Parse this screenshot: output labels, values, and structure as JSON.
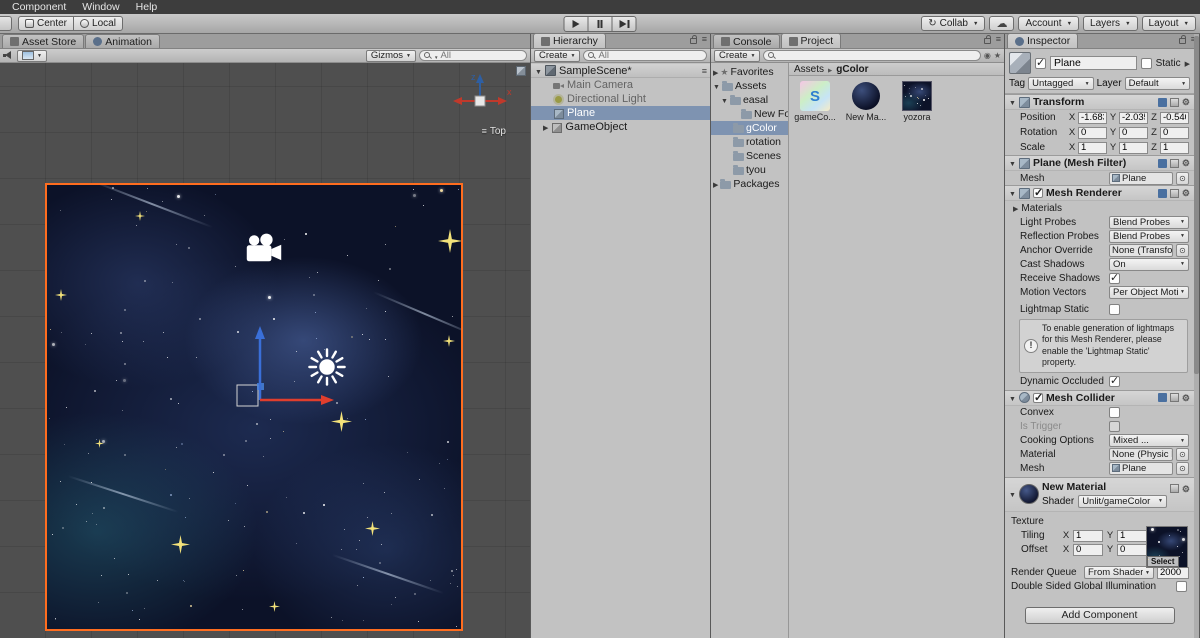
{
  "menu": {
    "component": "Component",
    "window": "Window",
    "help": "Help"
  },
  "toolbar": {
    "center": "Center",
    "local": "Local",
    "collab": "Collab",
    "account": "Account",
    "layers": "Layers",
    "layout": "Layout"
  },
  "scene": {
    "tab_asset_store": "Asset Store",
    "tab_animation": "Animation",
    "gizmos": "Gizmos",
    "search": "All",
    "view_label": "Top",
    "axis_x": "x",
    "axis_z": "z"
  },
  "hierarchy": {
    "tab": "Hierarchy",
    "create": "Create",
    "search": "All",
    "scene_name": "SampleScene*",
    "items": [
      {
        "label": "Main Camera"
      },
      {
        "label": "Directional Light"
      },
      {
        "label": "Plane"
      },
      {
        "label": "GameObject"
      }
    ]
  },
  "project": {
    "tab_console": "Console",
    "tab_project": "Project",
    "create": "Create",
    "search": "",
    "breadcrumb_root": "Assets",
    "breadcrumb_current": "gColor",
    "tree": [
      {
        "label": "Favorites"
      },
      {
        "label": "Assets"
      },
      {
        "label": "easal"
      },
      {
        "label": "New Fol..."
      },
      {
        "label": "gColor"
      },
      {
        "label": "rotation"
      },
      {
        "label": "Scenes"
      },
      {
        "label": "tyou"
      },
      {
        "label": "Packages"
      }
    ],
    "assets": [
      {
        "label": "gameCo...",
        "letter": "S"
      },
      {
        "label": "New Ma..."
      },
      {
        "label": "yozora"
      }
    ]
  },
  "inspector": {
    "tab": "Inspector",
    "name": "Plane",
    "static_label": "Static",
    "tag_label": "Tag",
    "tag": "Untagged",
    "layer_label": "Layer",
    "layer": "Default",
    "transform": {
      "title": "Transform",
      "position_label": "Position",
      "rotation_label": "Rotation",
      "scale_label": "Scale",
      "x": "X",
      "y": "Y",
      "z": "Z",
      "position": {
        "x": "-1.6830",
        "y": "-2.0351",
        "z": "-0.5401"
      },
      "rotation": {
        "x": "0",
        "y": "0",
        "z": "0"
      },
      "scale": {
        "x": "1",
        "y": "1",
        "z": "1"
      }
    },
    "mesh_filter": {
      "title": "Plane (Mesh Filter)",
      "mesh_label": "Mesh",
      "mesh": "Plane"
    },
    "mesh_renderer": {
      "title": "Mesh Renderer",
      "materials_label": "Materials",
      "light_probes_label": "Light Probes",
      "light_probes": "Blend Probes",
      "reflection_probes_label": "Reflection Probes",
      "reflection_probes": "Blend Probes",
      "anchor_override_label": "Anchor Override",
      "anchor_override": "None (Transform)",
      "cast_shadows_label": "Cast Shadows",
      "cast_shadows": "On",
      "receive_shadows_label": "Receive Shadows",
      "motion_vectors_label": "Motion Vectors",
      "motion_vectors": "Per Object Motion",
      "lightmap_static_label": "Lightmap Static",
      "info": "To enable generation of lightmaps for this Mesh Renderer, please enable the 'Lightmap Static' property.",
      "dynamic_occluded_label": "Dynamic Occluded"
    },
    "mesh_collider": {
      "title": "Mesh Collider",
      "convex_label": "Convex",
      "is_trigger_label": "Is Trigger",
      "cooking_options_label": "Cooking Options",
      "cooking_options": "Mixed ...",
      "material_label": "Material",
      "material": "None (Physic Material)",
      "mesh_label": "Mesh",
      "mesh": "Plane"
    },
    "material": {
      "title": "New Material",
      "shader_label": "Shader",
      "shader": "Unlit/gameColor",
      "texture_section": "Texture",
      "tiling_label": "Tiling",
      "offset_label": "Offset",
      "x": "X",
      "y": "Y",
      "tiling": {
        "x": "1",
        "y": "1"
      },
      "offset": {
        "x": "0",
        "y": "0"
      },
      "select_label": "Select",
      "render_queue_label": "Render Queue",
      "render_queue_mode": "From Shader",
      "render_queue": "2000",
      "dsgi_label": "Double Sided Global Illumination"
    },
    "add_component": "Add Component"
  },
  "colors": {
    "selection": "#7e93b1",
    "accent_orange": "#ff6d1f",
    "panel": "#c2c2c2"
  }
}
